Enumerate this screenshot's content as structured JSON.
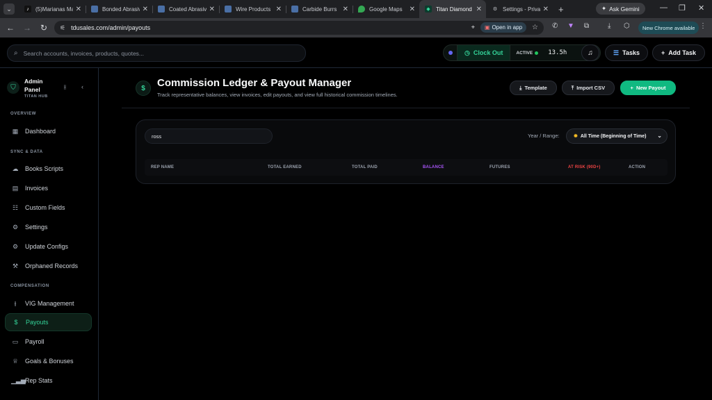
{
  "browser": {
    "tabs": [
      {
        "title": "(5)Marianas Ma",
        "icon": "tiktok-icon",
        "color": "#111111"
      },
      {
        "title": "Bonded Abrasiv",
        "icon": "site-icon",
        "color": "#4a6fa5"
      },
      {
        "title": "Coated Abrasiv",
        "icon": "site-icon",
        "color": "#4a6fa5"
      },
      {
        "title": "Wire Products",
        "icon": "site-icon",
        "color": "#4a6fa5"
      },
      {
        "title": "Carbide Burrs",
        "icon": "site-icon",
        "color": "#4a6fa5"
      },
      {
        "title": "Google Maps",
        "icon": "maps-icon",
        "color": "#34a853"
      },
      {
        "title": "Titan Diamond",
        "icon": "titan-icon",
        "color": "#10b981"
      },
      {
        "title": "Settings - Priva",
        "icon": "gear-icon",
        "color": "#9aa0a6"
      }
    ],
    "active_tab_index": 6,
    "ask_gemini": "Ask Gemini",
    "url": "tdusales.com/admin/payouts",
    "open_in_app": "Open in app",
    "new_chrome": "New Chrome available"
  },
  "topbar": {
    "search_placeholder": "Search accounts, invoices, products, quotes...",
    "clock_out": "Clock Out",
    "status": "ACTIVE",
    "hours": "13.5h",
    "tasks": "Tasks",
    "add_task": "Add Task"
  },
  "sidebar": {
    "brand_title": "Admin Panel",
    "brand_sub": "TITAN HUB",
    "sections": {
      "overview": "OVERVIEW",
      "sync": "SYNC & DATA",
      "compensation": "COMPENSATION"
    },
    "items": [
      {
        "label": "Dashboard",
        "icon": "grid-icon"
      },
      {
        "label": "Books Scripts",
        "icon": "cloud-icon"
      },
      {
        "label": "Invoices",
        "icon": "document-icon"
      },
      {
        "label": "Custom Fields",
        "icon": "database-icon"
      },
      {
        "label": "Settings",
        "icon": "gear-icon"
      },
      {
        "label": "Update Configs",
        "icon": "gear-icon"
      },
      {
        "label": "Orphaned Records",
        "icon": "wrench-icon"
      },
      {
        "label": "VIG Management",
        "icon": "sliders-icon"
      },
      {
        "label": "Payouts",
        "icon": "dollar-icon"
      },
      {
        "label": "Payroll",
        "icon": "wallet-icon"
      },
      {
        "label": "Goals & Bonuses",
        "icon": "trophy-icon"
      },
      {
        "label": "Rep Stats",
        "icon": "bar-chart-icon"
      }
    ],
    "active_item": "Payouts"
  },
  "page": {
    "title": "Commission Ledger & Payout Manager",
    "subtitle": "Track representative balances, view invoices, edit payouts, and view full historical commission timelines.",
    "template_btn": "Template",
    "import_btn": "Import CSV",
    "new_payout_btn": "New Payout"
  },
  "ledger": {
    "filter_value": "ross",
    "range_label": "Year / Range:",
    "range_value": "All Time (Beginning of Time)",
    "columns": [
      "REP NAME",
      "TOTAL EARNED",
      "TOTAL PAID",
      "BALANCE",
      "FUTURES",
      "AT RISK (90D+)",
      "ACTION"
    ],
    "rows": []
  },
  "colors": {
    "accent": "#10b981",
    "balance_header": "#a855f7",
    "at_risk_header": "#ef4444"
  }
}
